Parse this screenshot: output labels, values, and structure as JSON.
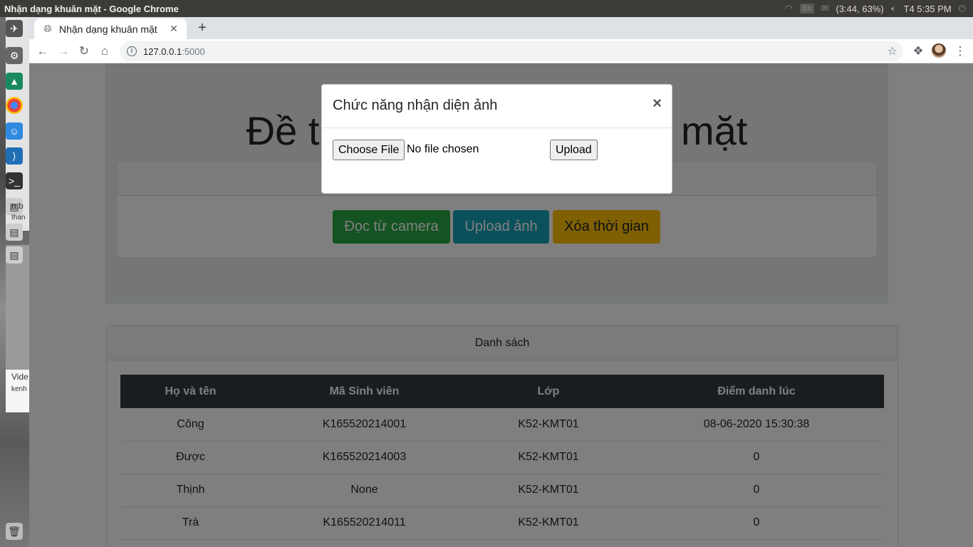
{
  "os": {
    "window_title": "Nhận dạng khuân mặt - Google Chrome",
    "lang": "En",
    "battery": "(3:44, 63%)",
    "clock": "T4  5:35 PM"
  },
  "launcher": {
    "item_text_1": "n b",
    "item_text_2": "than",
    "item_text_3": "Vide",
    "item_text_4": "kenh"
  },
  "browser": {
    "tab_title": "Nhận dạng khuân mặt",
    "url_host": "127.0.0.1",
    "url_port": ":5000"
  },
  "page": {
    "title": "Đề tài nhận dạng khuân mặt",
    "buttons": {
      "camera": "Đọc từ camera",
      "upload": "Upload ảnh",
      "clear": "Xóa thời gian"
    },
    "list": {
      "header": "Danh sách",
      "columns": [
        "Họ và tên",
        "Mã Sinh viên",
        "Lớp",
        "Điểm danh lúc"
      ],
      "rows": [
        [
          "Công",
          "K165520214001",
          "K52-KMT01",
          "08-06-2020 15:30:38"
        ],
        [
          "Được",
          "K165520214003",
          "K52-KMT01",
          "0"
        ],
        [
          "Thịnh",
          "None",
          "K52-KMT01",
          "0"
        ],
        [
          "Trà",
          "K165520214011",
          "K52-KMT01",
          "0"
        ]
      ]
    }
  },
  "modal": {
    "title": "Chức năng nhận diện ảnh",
    "close": "×",
    "choose_file": "Choose File",
    "file_status": "No file chosen",
    "upload": "Upload"
  },
  "colors": {
    "success": "#28a745",
    "info": "#17a2b8",
    "warning": "#ffc107",
    "table_head": "#343a40"
  }
}
